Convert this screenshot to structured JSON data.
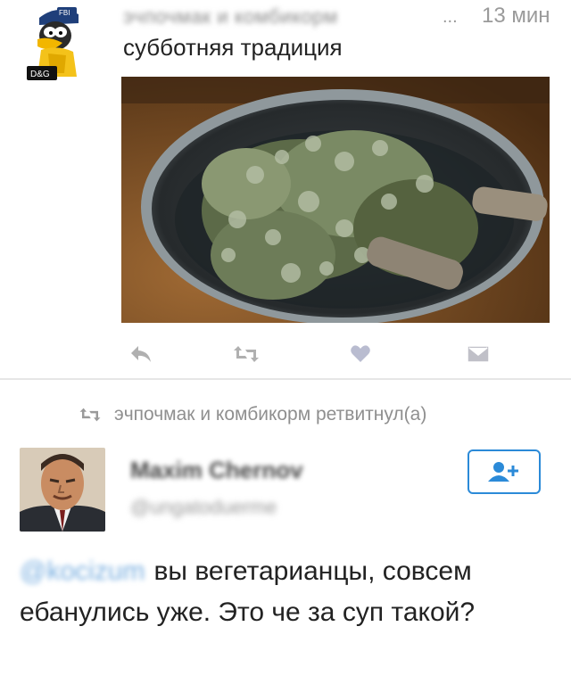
{
  "tweet": {
    "author_blurred": "эчпочмак и комбикорм",
    "ellipsis": "...",
    "time": "13 мин",
    "text": "субботняя традиция",
    "avatar_badges": {
      "top": "FBI",
      "bottom": "D&G"
    },
    "icons": [
      "reply-icon",
      "retweet-icon",
      "like-icon",
      "dm-icon"
    ]
  },
  "retweet_notice": {
    "text": "эчпочмак и комбикорм ретвитнул(а)"
  },
  "reply": {
    "author_name_blurred": "Maxim Chernov",
    "author_handle_blurred": "@ungatoduerme",
    "mention_blurred": "@kocizum",
    "text": "вы вегетарианцы, совсем ебанулись уже. Это че за суп такой?"
  },
  "colors": {
    "accent": "#2b8ad8",
    "muted": "#9a9a9a",
    "like": "#b9bcd0"
  }
}
